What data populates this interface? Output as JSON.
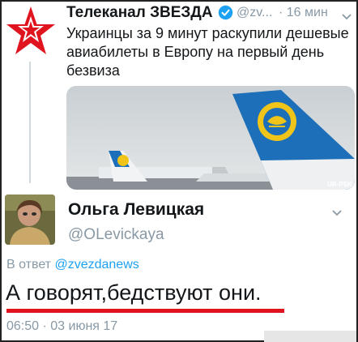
{
  "quoted_tweet": {
    "author_name": "Телеканал ЗВЕЗДА",
    "handle": "@zv...",
    "time": "· 16 мин",
    "text": "Украинцы за 9 минут раскупили дешевые авиабилеты в Европу на первый день безвиза",
    "avatar_icon": "red-star-logo-icon",
    "image_text": "UR-PSK"
  },
  "reply": {
    "author_name": "Ольга Левицкая",
    "handle": "@OLevickaya",
    "context_prefix": "В ответ",
    "context_mention": "@zvezdanews",
    "text": "А говорят,бедствуют они.",
    "timestamp": "06:50 · 03 июня 17"
  },
  "colors": {
    "accent": "#1da1f2",
    "muted": "#8899a6",
    "highlight_underline": "#e0141e",
    "logo_red": "#e0141e"
  }
}
